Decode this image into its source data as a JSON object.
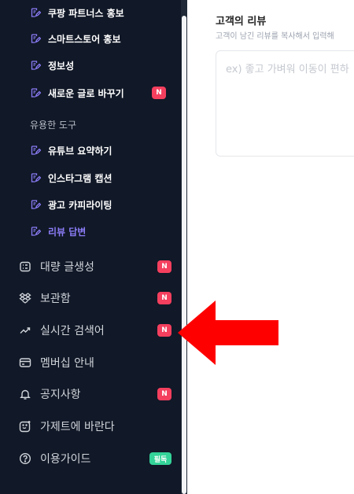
{
  "sidebar": {
    "top_sub_items": [
      {
        "label": "쿠팡 파트너스 홍보"
      },
      {
        "label": "스마트스토어 홍보"
      },
      {
        "label": "정보성"
      },
      {
        "label": "새로운 글로 바꾸기",
        "badge": "N"
      }
    ],
    "tools_section_label": "유용한 도구",
    "tool_items": [
      {
        "label": "유튜브 요약하기"
      },
      {
        "label": "인스타그램 캡션"
      },
      {
        "label": "광고 카피라이팅"
      },
      {
        "label": "리뷰 답변",
        "active": true
      }
    ],
    "main_items": [
      {
        "label": "대량 글생성",
        "icon": "list-icon",
        "badge": "N"
      },
      {
        "label": "보관함",
        "icon": "dropbox-icon",
        "badge": "N"
      },
      {
        "label": "실시간 검색어",
        "icon": "trending-icon",
        "badge": "N"
      },
      {
        "label": "멤버십 안내",
        "icon": "card-icon"
      },
      {
        "label": "공지사항",
        "icon": "bell-icon",
        "badge": "N"
      },
      {
        "label": "가제트에 바란다",
        "icon": "smile-icon"
      },
      {
        "label": "이용가이드",
        "icon": "help-icon",
        "badge": "필독"
      }
    ]
  },
  "main": {
    "title": "고객의 리뷰",
    "description": "고객이 남긴 리뷰를 복사해서 입력해",
    "review_placeholder": "ex) 좋고 가벼워 이동이 편하"
  },
  "colors": {
    "sidebar_bg": "#111827",
    "active": "#8b7cf6",
    "badge_red": "#f43f5e",
    "badge_green": "#34d399",
    "arrow": "#ff0000"
  }
}
